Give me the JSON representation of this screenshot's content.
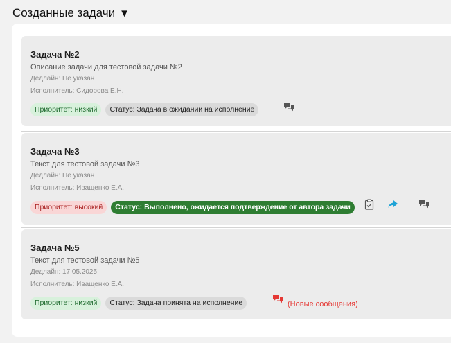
{
  "section": {
    "title": "Созданные задачи",
    "caret": "▼"
  },
  "tasks": [
    {
      "title": "Задача №2",
      "description": "Описание задачи для тестовой задачи №2",
      "deadline": "Дедлайн: Не указан",
      "assignee": "Исполнитель: Сидорова Е.Н.",
      "priority": "Приоритет: низкий",
      "status": "Статус: Задача в ожидании на исполнение"
    },
    {
      "title": "Задача №3",
      "description": "Текст для тестовой задачи №3",
      "deadline": "Дедлайн: Не указан",
      "assignee": "Исполнитель: Иващенко Е.А.",
      "priority": "Приоритет: высокий",
      "status": "Статус: Выполнено, ожидается подтверждение от автора задачи"
    },
    {
      "title": "Задача №5",
      "description": "Текст для тестовой задачи №5",
      "deadline": "Дедлайн: 17.05.2025",
      "assignee": "Исполнитель: Иващенко Е.А.",
      "priority": "Приоритет: низкий",
      "status": "Статус: Задача принята на исполнение",
      "new_messages": "(Новые сообщения)"
    }
  ],
  "colors": {
    "priority_low_bg": "#d8f1dc",
    "priority_high_bg": "#f9d6d6",
    "status_done_bg": "#2e7d32",
    "new_messages": "#e53935",
    "return_icon": "#1fa3d6"
  },
  "icons": {
    "chat": "chat-icon",
    "confirm": "clipboard-check-icon",
    "return": "return-arrow-icon"
  }
}
